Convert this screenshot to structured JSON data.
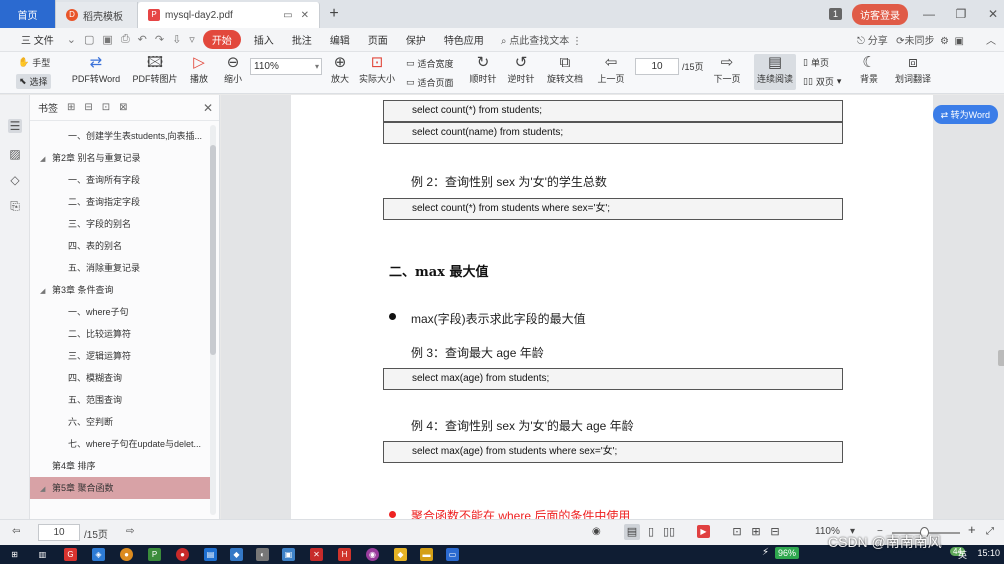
{
  "titlebar": {
    "home_tab": "首页",
    "template_tab": "稻壳模板",
    "doc_tab": "mysql-day2.pdf",
    "page_badge": "1",
    "guest_login": "访客登录"
  },
  "menubar": {
    "file": "三 文件",
    "start": "开始",
    "items": [
      "插入",
      "批注",
      "编辑",
      "页面",
      "保护",
      "特色应用"
    ],
    "search": "点此查找文本",
    "right": [
      "分享",
      "未同步"
    ]
  },
  "ribbon": {
    "hand": "手型",
    "select": "选择",
    "pdf_to_word": "PDF转Word",
    "pdf_to_image": "PDF转图片",
    "play": "播放",
    "zoom_out": "缩小",
    "zoom_value": "110%",
    "zoom_in": "放大",
    "actual_size": "实际大小",
    "fit_width": "适合宽度",
    "fit_page": "适合页面",
    "clockwise": "顺时针",
    "counterclockwise": "逆时针",
    "rotate_doc": "旋转文档",
    "prev_page": "上一页",
    "page_input": "10",
    "page_total": "/15页",
    "next_page": "下一页",
    "continuous": "连续阅读",
    "single_page": "单页",
    "double_page": "双页",
    "background": "背景",
    "translate": "划词翻译"
  },
  "bookmark": {
    "title": "书签",
    "items": [
      {
        "text": "一、创建学生表students,向表插...",
        "level": 1
      },
      {
        "text": "第2章 别名与重复记录",
        "level": 0,
        "expanded": true
      },
      {
        "text": "一、查询所有字段",
        "level": 1
      },
      {
        "text": "二、查询指定字段",
        "level": 1
      },
      {
        "text": "三、字段的别名",
        "level": 1
      },
      {
        "text": "四、表的别名",
        "level": 1
      },
      {
        "text": "五、消除重复记录",
        "level": 1
      },
      {
        "text": "第3章 条件查询",
        "level": 0,
        "expanded": true
      },
      {
        "text": "一、where子句",
        "level": 1
      },
      {
        "text": "二、比较运算符",
        "level": 1
      },
      {
        "text": "三、逻辑运算符",
        "level": 1
      },
      {
        "text": "四、模糊查询",
        "level": 1
      },
      {
        "text": "五、范围查询",
        "level": 1
      },
      {
        "text": "六、空判断",
        "level": 1
      },
      {
        "text": "七、where子句在update与delet...",
        "level": 1
      },
      {
        "text": "第4章 排序",
        "level": 0
      },
      {
        "text": "第5章 聚合函数",
        "level": 0,
        "expanded": true,
        "selected": true
      }
    ]
  },
  "document": {
    "code1": "select count(*) from students;",
    "code2": "select count(name) from students;",
    "ex2": "例 2：查询性别 sex 为'女'的学生总数",
    "code3": "select count(*) from students where sex='女';",
    "heading_max": "二、max 最大值",
    "bullet_max": "max(字段)表示求此字段的最大值",
    "ex3": "例 3：查询最大 age 年龄",
    "code4": "select max(age) from students;",
    "ex4": "例 4：查询性别 sex 为'女'的最大 age 年龄",
    "code5": "select max(age) from students where sex='女';",
    "note_red": "聚合函数不能在 where 后面的条件中使用",
    "to_word": "转为Word"
  },
  "statusbar": {
    "page_input": "10",
    "page_total": "/15页",
    "zoom": "110%"
  },
  "taskbar": {
    "battery": "96%",
    "lang": "英",
    "badge": "44",
    "time": "15:10",
    "watermark": "CSDN @南南南风"
  }
}
